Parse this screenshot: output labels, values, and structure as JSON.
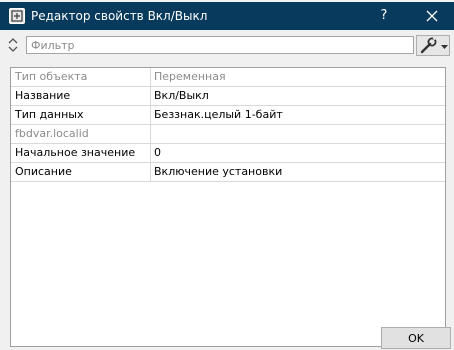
{
  "window": {
    "title": "Редактор свойств Вкл/Выкл",
    "help_label": "?"
  },
  "toolbar": {
    "filter_placeholder": "Фильтр",
    "sort_icon": "sort-arrows-icon",
    "tool_icon": "wrench-icon"
  },
  "properties": {
    "rows": [
      {
        "name": "Тип объекта",
        "value": "Переменная",
        "enabled": false
      },
      {
        "name": "Название",
        "value": "Вкл/Выкл",
        "enabled": true
      },
      {
        "name": "Тип данных",
        "value": "Беззнак.целый 1-байт",
        "enabled": true
      },
      {
        "name": "fbdvar.localid",
        "value": "",
        "enabled": false
      },
      {
        "name": "Начальное значение",
        "value": "0",
        "enabled": true
      },
      {
        "name": "Описание",
        "value": "Включение установки",
        "enabled": true
      }
    ]
  },
  "footer": {
    "ok_label": "OK"
  },
  "colors": {
    "titlebar": "#083a5e",
    "body": "#f0f0f0",
    "disabled_text": "#8c8c8c"
  }
}
